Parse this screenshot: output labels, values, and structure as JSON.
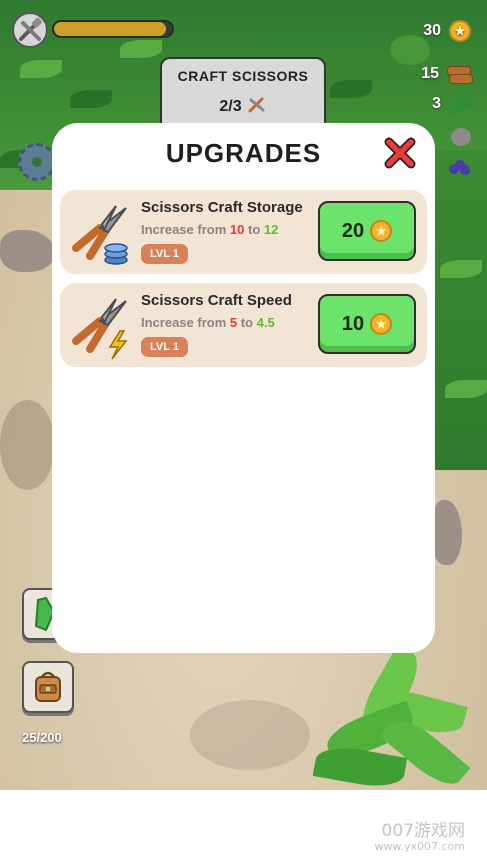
{
  "hud": {
    "resources": [
      {
        "icon": "coin-icon",
        "value": "30"
      },
      {
        "icon": "wood-icon",
        "value": "15"
      },
      {
        "icon": "leaf-icon",
        "value": "3"
      },
      {
        "icon": "stone-icon",
        "value": ""
      },
      {
        "icon": "berry-icon",
        "value": ""
      }
    ],
    "xp_progress": 0.95,
    "inventory_count": "25/200"
  },
  "craft_panel": {
    "title": "CRAFT SCISSORS",
    "count": "2/3"
  },
  "modal": {
    "title": "UPGRADES",
    "upgrades": [
      {
        "name": "Scissors Craft Storage",
        "desc_prefix": "Increase from",
        "from": "10",
        "desc_mid": "to",
        "to": "12",
        "level": "LVL 1",
        "price": "20",
        "icon": "scissors-storage-icon"
      },
      {
        "name": "Scissors Craft Speed",
        "desc_prefix": "Increase from",
        "from": "5",
        "desc_mid": "to",
        "to": "4.5",
        "level": "LVL 1",
        "price": "10",
        "icon": "scissors-speed-icon"
      }
    ]
  },
  "watermark": {
    "line1": "007游戏网",
    "line2": "www.yx007.com"
  },
  "colors": {
    "buy_button": "#6ce36a",
    "level_badge": "#d9825a",
    "from_value": "#e53935",
    "to_value": "#5bbf2c",
    "card_bg": "#f3e5d6"
  }
}
